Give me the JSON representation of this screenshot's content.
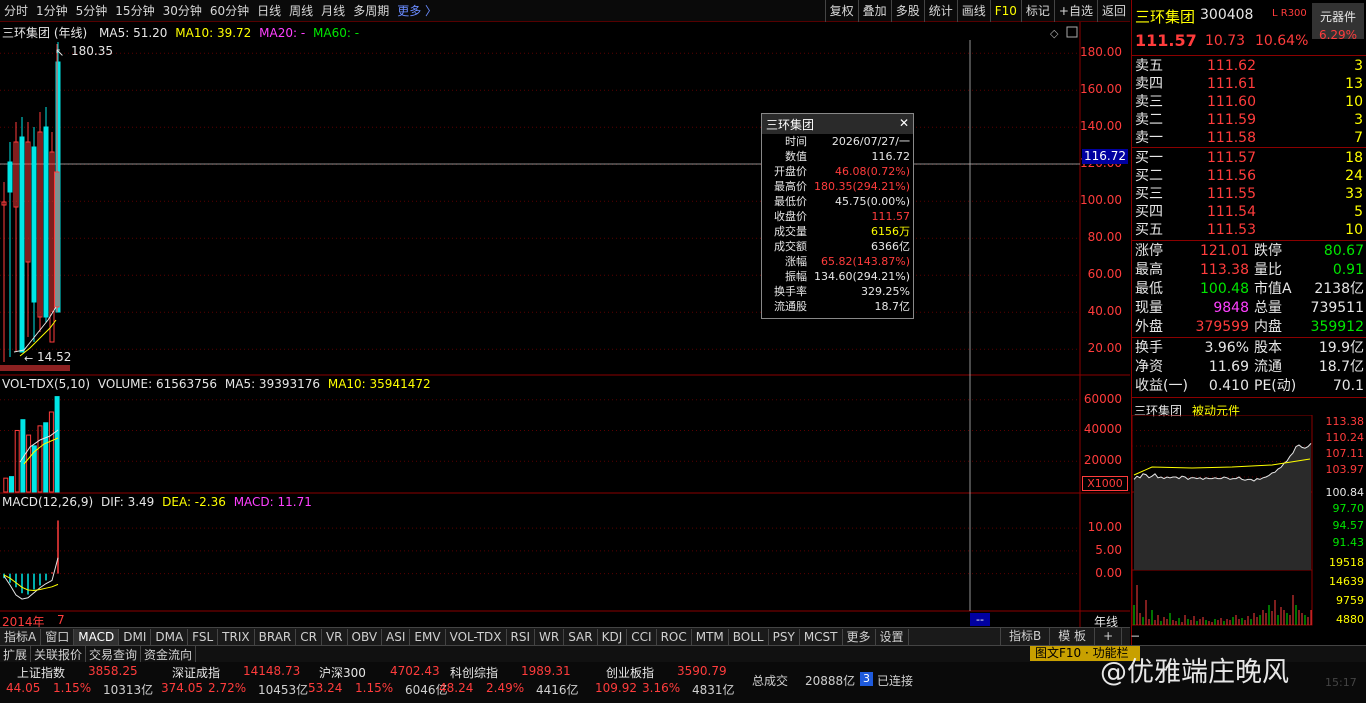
{
  "toolbar": {
    "periods": [
      "分时",
      "1分钟",
      "5分钟",
      "15分钟",
      "30分钟",
      "60分钟",
      "日线",
      "周线",
      "月线",
      "多周期"
    ],
    "more": "更多 〉",
    "right": [
      "复权",
      "叠加",
      "多股",
      "统计",
      "画线",
      "F10",
      "标记",
      "+自选",
      "返回"
    ]
  },
  "chart": {
    "title": "三环集团 (年线)",
    "ma5": "MA5: 51.20",
    "ma10": "MA10: 39.72",
    "ma20": "MA20: -",
    "ma60": "MA60: -",
    "high_label": "180.35",
    "low_label": "14.52",
    "price_axis": [
      "180.00",
      "160.00",
      "140.00",
      "120.00",
      "100.00",
      "80.00",
      "60.00",
      "40.00",
      "20.00"
    ],
    "crosshair_value": "116.72",
    "vol_legend": "VOL-TDX(5,10)",
    "volume": "VOLUME: 61563756",
    "vol_ma5": "MA5: 39393176",
    "vol_ma10": "MA10: 35941472",
    "vol_axis": [
      "60000",
      "40000",
      "20000"
    ],
    "vol_unit": "X1000",
    "macd_legend": "MACD(12,26,9)",
    "dif": "DIF: 3.49",
    "dea": "DEA: -2.36",
    "macd": "MACD: 11.71",
    "macd_axis": [
      "10.00",
      "5.00",
      "0.00"
    ],
    "date_left": "2014年",
    "date_num": "7",
    "cursor_date": "--",
    "period_label": "年线",
    "candles": [
      [
        9,
        1,
        120,
        0.5
      ],
      [
        10,
        2,
        95,
        0.8
      ],
      [
        40,
        5,
        10,
        0.2
      ],
      [
        47,
        3,
        12,
        0.1
      ],
      [
        37,
        20,
        18,
        0.6
      ],
      [
        30,
        17,
        22,
        0.5
      ],
      [
        43,
        25,
        28,
        1
      ],
      [
        45,
        22,
        48,
        1.7
      ],
      [
        52,
        30,
        40,
        4.4
      ],
      [
        180,
        46,
        112,
        6.2
      ]
    ],
    "ma_line": [
      [
        0,
        22
      ],
      [
        3,
        21
      ],
      [
        5,
        24
      ],
      [
        7,
        33
      ],
      [
        9,
        38
      ]
    ],
    "volumes": [
      9,
      10,
      40,
      47,
      37,
      30,
      43,
      45,
      52,
      62
    ],
    "macd_vals": [
      -1,
      -2,
      -3,
      -4.3,
      -4.6,
      -3.5,
      -2.6,
      -1.5,
      0.3,
      11.7
    ],
    "dif_line": [
      -0.5,
      -2.5,
      -4.7,
      -5.6,
      -5.3,
      -4.2,
      -3.1,
      -2.2,
      -1.5,
      3.5
    ],
    "dea_line": [
      -0.3,
      -1,
      -2,
      -3,
      -3.6,
      -3.7,
      -3.5,
      -3.2,
      -2.9,
      -2.36
    ]
  },
  "tooltip": {
    "title": "三环集团",
    "rows": [
      {
        "k": "时间",
        "v": "2026/07/27/一",
        "c": "white"
      },
      {
        "k": "数值",
        "v": "116.72",
        "c": "white"
      },
      {
        "k": "开盘价",
        "v": "46.08(0.72%)",
        "c": "red"
      },
      {
        "k": "最高价",
        "v": "180.35(294.21%)",
        "c": "red"
      },
      {
        "k": "最低价",
        "v": "45.75(0.00%)",
        "c": "white"
      },
      {
        "k": "收盘价",
        "v": "111.57",
        "c": "red"
      },
      {
        "k": "成交量",
        "v": "6156万",
        "c": "yellow"
      },
      {
        "k": "成交额",
        "v": "6366亿",
        "c": "white"
      },
      {
        "k": "涨幅",
        "v": "65.82(143.87%)",
        "c": "red"
      },
      {
        "k": "振幅",
        "v": "134.60(294.21%)",
        "c": "white"
      },
      {
        "k": "换手率",
        "v": "329.25%",
        "c": "white"
      },
      {
        "k": "流通股",
        "v": "18.7亿",
        "c": "white"
      }
    ]
  },
  "quote": {
    "name": "三环集团",
    "code": "300408",
    "tags": "L R300",
    "price": "111.57",
    "change": "10.73",
    "pct": "10.64%",
    "sector": "元器件",
    "sector_pct": "6.29%"
  },
  "sell": [
    {
      "k": "卖五",
      "p": "111.62",
      "q": "3"
    },
    {
      "k": "卖四",
      "p": "111.61",
      "q": "13"
    },
    {
      "k": "卖三",
      "p": "111.60",
      "q": "10"
    },
    {
      "k": "卖二",
      "p": "111.59",
      "q": "3"
    },
    {
      "k": "卖一",
      "p": "111.58",
      "q": "7"
    }
  ],
  "buy": [
    {
      "k": "买一",
      "p": "111.57",
      "q": "18"
    },
    {
      "k": "买二",
      "p": "111.56",
      "q": "24"
    },
    {
      "k": "买三",
      "p": "111.55",
      "q": "33"
    },
    {
      "k": "买四",
      "p": "111.54",
      "q": "5"
    },
    {
      "k": "买五",
      "p": "111.53",
      "q": "10"
    }
  ],
  "stats": [
    [
      "涨停",
      "121.01",
      "red",
      "跌停",
      "80.67",
      "green"
    ],
    [
      "最高",
      "113.38",
      "red",
      "量比",
      "0.91",
      "green"
    ],
    [
      "最低",
      "100.48",
      "green",
      "市值A",
      "2138亿",
      "white"
    ],
    [
      "现量",
      "9848",
      "magenta",
      "总量",
      "739511",
      "white"
    ],
    [
      "外盘",
      "379599",
      "red",
      "内盘",
      "359912",
      "green"
    ]
  ],
  "stats2": [
    [
      "换手",
      "3.96%",
      "white",
      "股本",
      "19.9亿",
      "white"
    ],
    [
      "净资",
      "11.69",
      "white",
      "流通",
      "18.7亿",
      "white"
    ],
    [
      "收益(一)",
      "0.410",
      "white",
      "PE(动)",
      "70.1",
      "white"
    ]
  ],
  "mini": {
    "name": "三环集团",
    "sector": "被动元件",
    "axis_red": [
      "113.38",
      "110.24",
      "107.11",
      "103.97"
    ],
    "mid": "100.84",
    "axis_green": [
      "97.70",
      "94.57",
      "91.43"
    ],
    "vol_axis": [
      "19518",
      "14639",
      "9759",
      "4880"
    ]
  },
  "tabs": [
    "指标A",
    "窗口",
    "MACD",
    "DMI",
    "DMA",
    "FSL",
    "TRIX",
    "BRAR",
    "CR",
    "VR",
    "OBV",
    "ASI",
    "EMV",
    "VOL-TDX",
    "RSI",
    "WR",
    "SAR",
    "KDJ",
    "CCI",
    "ROC",
    "MTM",
    "BOLL",
    "PSY",
    "MCST",
    "更多",
    "设置"
  ],
  "tabs_right": [
    "指标B",
    "模 板",
    "+",
    "−"
  ],
  "bottom1": [
    "扩展",
    "关联报价",
    "交易查询",
    "资金流向"
  ],
  "ticker": "图文F10 · 功能栏",
  "indices": [
    {
      "n": "上证指数",
      "v": "3858.25",
      "c": "44.05",
      "p": "1.15%",
      "a": "10313亿"
    },
    {
      "n": "深证成指",
      "v": "14148.73",
      "c": "374.05",
      "p": "2.72%",
      "a": "10453亿"
    },
    {
      "n": "沪深300",
      "v": "4702.43",
      "c": "53.24",
      "p": "1.15%",
      "a": "6046亿"
    },
    {
      "n": "科创综指",
      "v": "1989.31",
      "c": "48.24",
      "p": "2.49%",
      "a": "4416亿"
    },
    {
      "n": "创业板指",
      "v": "3590.79",
      "c": "109.92",
      "p": "3.16%",
      "a": "4831亿"
    }
  ],
  "total_label": "总成交",
  "total": "20888亿",
  "conn_num": "3",
  "conn": "已连接",
  "watermark": "@优雅端庄晚风",
  "time": "15:17"
}
